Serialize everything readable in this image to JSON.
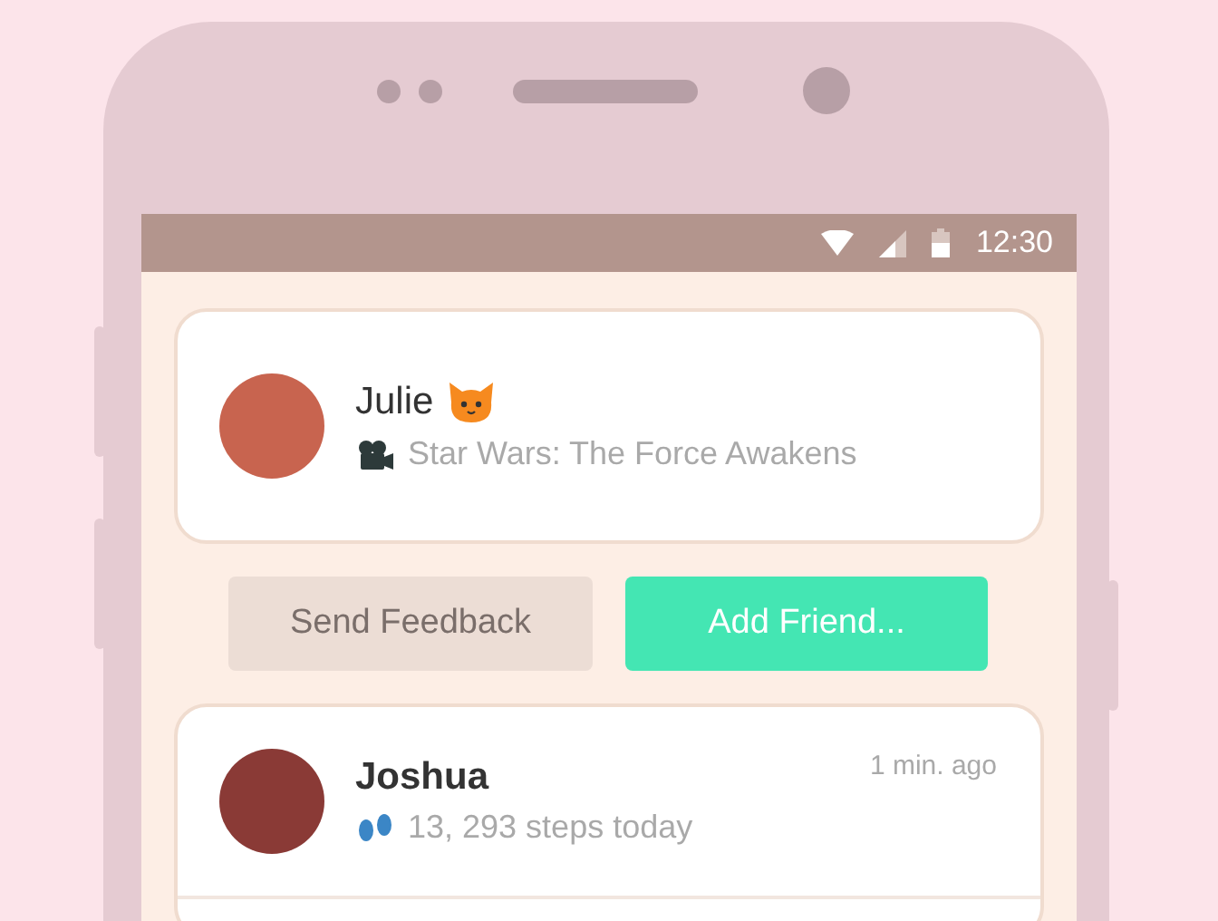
{
  "status_bar": {
    "time": "12:30"
  },
  "profile": {
    "name": "Julie",
    "status": "Star Wars: The Force Awakens"
  },
  "buttons": [
    {
      "label": "Send Feedback",
      "kind": "secondary"
    },
    {
      "label": "Add Friend...",
      "kind": "primary"
    }
  ],
  "feed": [
    {
      "name": "Joshua",
      "time": "1 min. ago",
      "activity": "13, 293 steps today"
    }
  ]
}
